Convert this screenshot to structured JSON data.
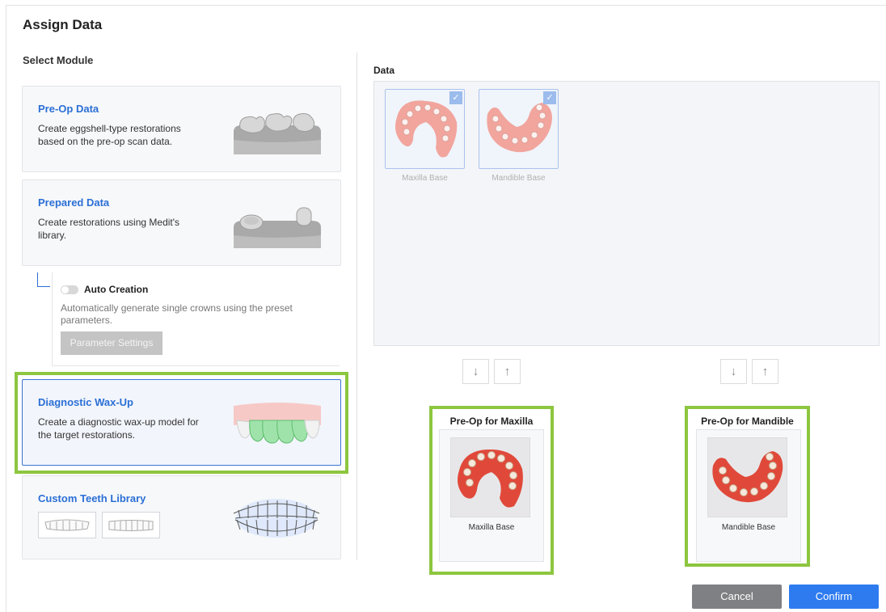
{
  "dialog": {
    "title": "Assign Data",
    "select_module_label": "Select Module"
  },
  "modules": {
    "preop": {
      "title": "Pre-Op Data",
      "desc": "Create eggshell-type restorations based on the pre-op scan data."
    },
    "prepared": {
      "title": "Prepared Data",
      "desc": "Create restorations using Medit's library."
    },
    "auto_creation": {
      "label": "Auto Creation",
      "enabled": false,
      "desc": "Automatically generate single crowns using the preset parameters.",
      "param_button": "Parameter Settings"
    },
    "wax": {
      "title": "Diagnostic Wax-Up",
      "desc": "Create a diagnostic wax-up model for the target restorations.",
      "selected": true
    },
    "custom": {
      "title": "Custom Teeth Library"
    }
  },
  "data_panel": {
    "label": "Data",
    "items": [
      {
        "caption": "Maxilla Base",
        "checked": true,
        "check_icon": "checkmark-icon"
      },
      {
        "caption": "Mandible Base",
        "checked": true,
        "check_icon": "checkmark-icon"
      }
    ]
  },
  "targets": {
    "maxilla": {
      "title": "Pre-Op for Maxilla",
      "caption": "Maxilla Base",
      "move_down_icon": "arrow-down-icon",
      "move_up_icon": "arrow-up-icon"
    },
    "mandible": {
      "title": "Pre-Op for Mandible",
      "caption": "Mandible Base",
      "move_down_icon": "arrow-down-icon",
      "move_up_icon": "arrow-up-icon"
    }
  },
  "footer": {
    "cancel": "Cancel",
    "confirm": "Confirm"
  },
  "colors": {
    "accent": "#2b6fd6",
    "confirm": "#2e7bf0",
    "cancel": "#7f8084",
    "highlight": "#8dc63f",
    "gum": "#e8736a"
  }
}
